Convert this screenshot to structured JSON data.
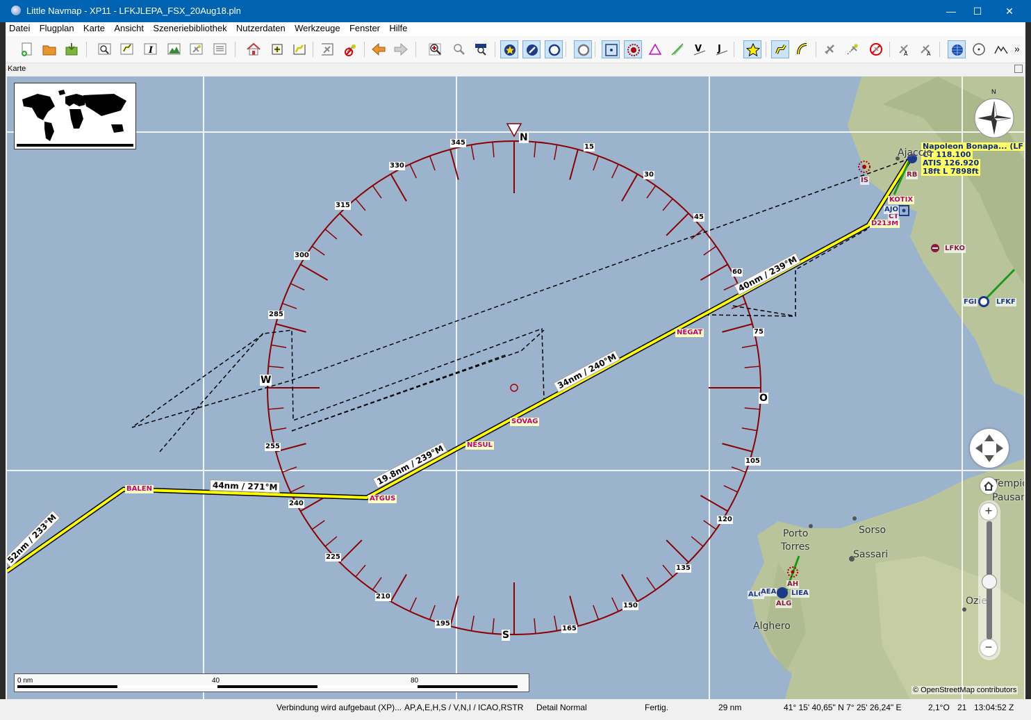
{
  "window": {
    "title": "Little Navmap - XP11 - LFKJLEPA_FSX_20Aug18.pln",
    "minimize": "—",
    "maximize": "☐",
    "close": "✕"
  },
  "menu": [
    "Datei",
    "Flugplan",
    "Karte",
    "Ansicht",
    "Szeneriebibliothek",
    "Nutzerdaten",
    "Werkzeuge",
    "Fenster",
    "Hilfe"
  ],
  "toolbar": {
    "more": "»"
  },
  "panel": {
    "title": "Karte"
  },
  "compass": {
    "north": "N",
    "east": "O",
    "south": "S",
    "west": "W",
    "labels": [
      "15",
      "30",
      "45",
      "60",
      "75",
      "105",
      "120",
      "135",
      "150",
      "165",
      "195",
      "210",
      "225",
      "240",
      "255",
      "285",
      "300",
      "315",
      "330",
      "345"
    ]
  },
  "route": {
    "legs": [
      "52nm / 233°M",
      "44nm / 271°M",
      "19.8nm / 239°M",
      "34nm / 240°M",
      "40nm / 239°M"
    ],
    "waypoints": [
      "BALEN",
      "ATGUS",
      "NESUL",
      "SOVAG",
      "NEGAT",
      "D213M",
      "KOTIX"
    ]
  },
  "airport": {
    "name": "Napoleon Bonapa... (LFKJ)",
    "ct": "CT 118.100",
    "atis": "ATIS 126.920",
    "info": "18ft L 7898ft"
  },
  "map_labels": {
    "ajaccio": "Ajaccio",
    "is": "IS",
    "rb": "RB",
    "ct": "CT",
    "ajo": "AJO",
    "lfko": "LFKO",
    "fgi": "FGI",
    "lfkf": "LFKF",
    "porto": "Porto",
    "torres": "Torres",
    "sorso": "Sorso",
    "sassari": "Sassari",
    "alghero": "Alghero",
    "tempio": "Tempio",
    "pausani": "Pausani",
    "ozieri": "Ozie",
    "liea": "LIEA",
    "alg": "ALG",
    "alg2": "ALG",
    "ah": "AH",
    "aea": "AEA"
  },
  "scale": {
    "l0": "0 nm",
    "l1": "40",
    "l2": "80"
  },
  "attribution": "© OpenStreetMap contributors",
  "status": {
    "connection": "Verbindung wird aufgebaut (XP)...",
    "filter": "AP,A,E,H,S / V,N,I / ICAO,RSTR",
    "detail": "Detail Normal",
    "state": "Fertig.",
    "distance": "29 nm",
    "position": "41° 15' 40,65\" N 7° 25' 26,24\" E",
    "magvar": "2,1°O",
    "day": "21",
    "time": "13:04:52 Z"
  },
  "colors": {
    "route": "#ffff00",
    "compass": "#8b0000",
    "waypoint": "#c2007a",
    "water": "#9bb3cd",
    "land": "#b9c49a"
  }
}
